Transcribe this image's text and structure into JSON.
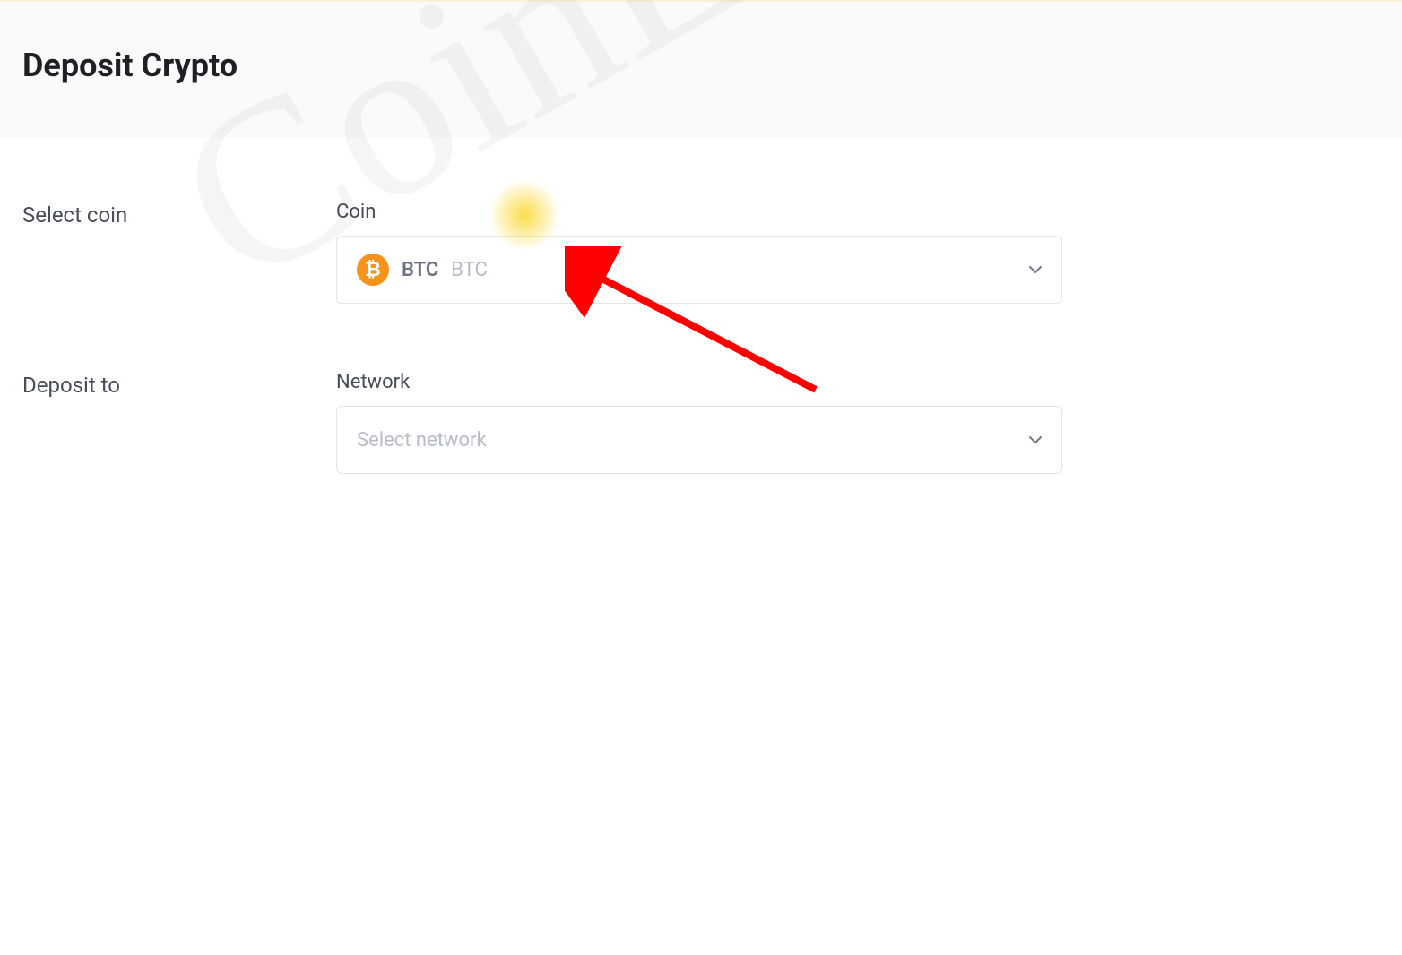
{
  "header": {
    "title": "Deposit Crypto"
  },
  "form": {
    "selectCoin": {
      "label": "Select coin",
      "fieldLabel": "Coin",
      "selected": {
        "symbol": "BTC",
        "name": "BTC",
        "iconChar": "₿"
      }
    },
    "depositTo": {
      "label": "Deposit to",
      "fieldLabel": "Network",
      "placeholder": "Select network"
    }
  },
  "watermark": {
    "text": "CoinLore"
  }
}
